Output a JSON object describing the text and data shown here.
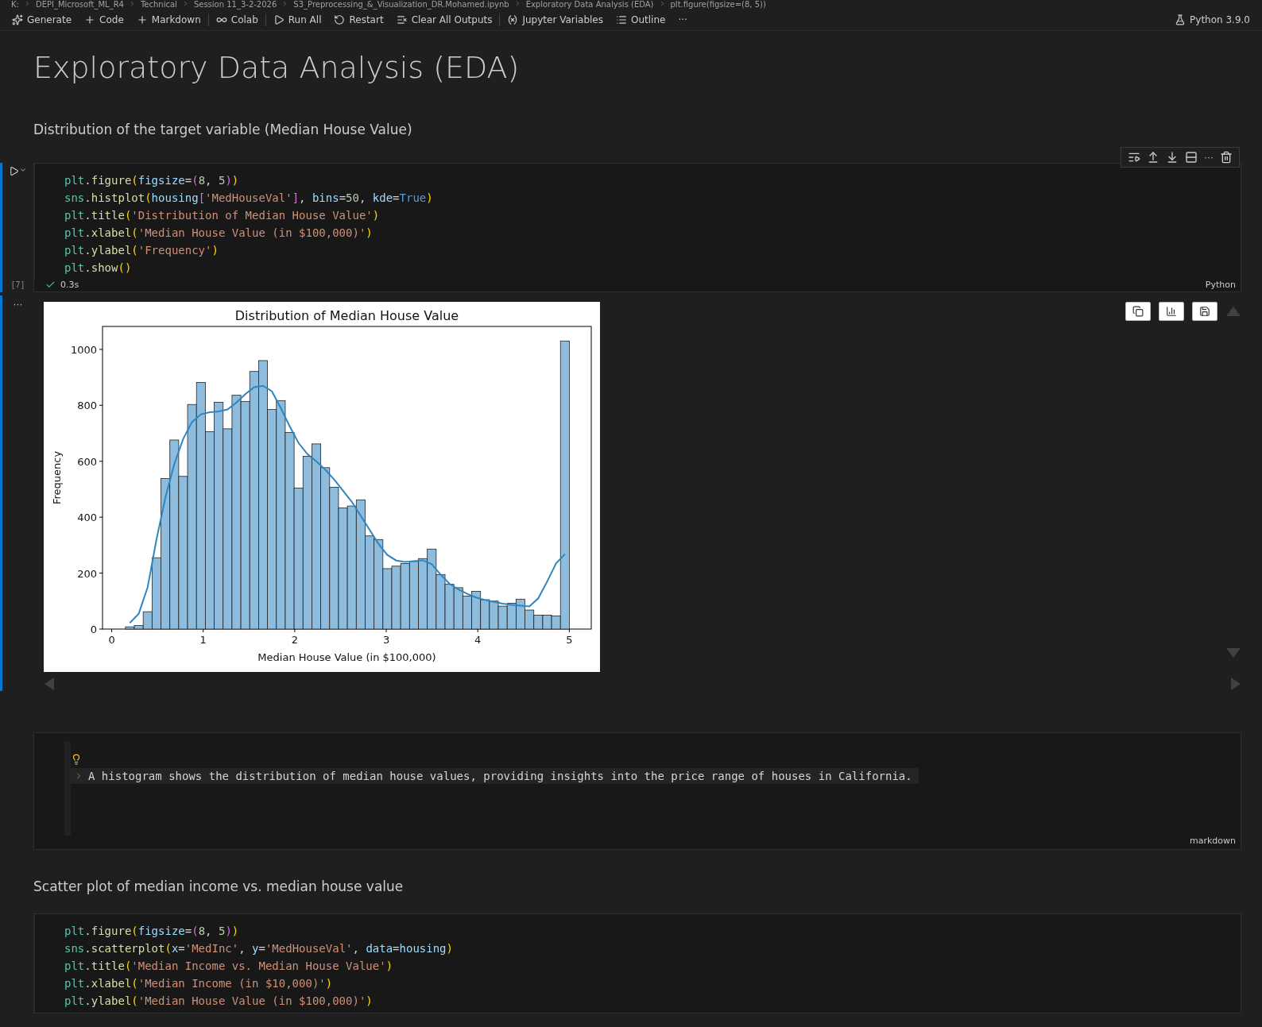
{
  "breadcrumb": [
    "K:",
    "DEPI_Microsoft_ML_R4",
    "Technical",
    "Session 11_3-2-2026",
    "S3_Preprocessing_&_Visualization_DR.Mohamed.ipynb",
    "Exploratory Data Analysis (EDA)",
    "plt.figure(figsize=(8, 5))"
  ],
  "toolbar": {
    "actions": [
      {
        "label": "Generate"
      },
      {
        "label": "Code"
      },
      {
        "label": "Markdown"
      },
      {
        "label": "Colab"
      },
      {
        "label": "Run All"
      },
      {
        "label": "Restart"
      },
      {
        "label": "Clear All Outputs"
      },
      {
        "label": "Jupyter Variables"
      },
      {
        "label": "Outline"
      }
    ],
    "more": "···",
    "kernel": "Python 3.9.0"
  },
  "heading": "Exploratory Data Analysis (EDA)",
  "subheading": "Distribution of the target variable (Median House Value)",
  "code_cell": {
    "lines": [
      "plt.figure(figsize=(8, 5))",
      "sns.histplot(housing['MedHouseVal'], bins=50, kde=True)",
      "plt.title('Distribution of Median House Value')",
      "plt.xlabel('Median House Value (in $100,000)')",
      "plt.ylabel('Frequency')",
      "plt.show()"
    ],
    "execution_count": "[7]",
    "succeeded": true,
    "duration": "0.3s",
    "language": "Python",
    "output_more": "···",
    "toolbar_more": "···"
  },
  "output": {
    "chart_data": {
      "type": "bar",
      "title": "Distribution of Median House Value",
      "xlabel": "Median House Value (in $100,000)",
      "ylabel": "Frequency",
      "x": [
        0.199,
        0.296,
        0.393,
        0.49,
        0.587,
        0.684,
        0.781,
        0.878,
        0.975,
        1.072,
        1.169,
        1.266,
        1.363,
        1.46,
        1.557,
        1.654,
        1.751,
        1.848,
        1.945,
        2.042,
        2.139,
        2.236,
        2.333,
        2.43,
        2.527,
        2.624,
        2.721,
        2.818,
        2.915,
        3.012,
        3.109,
        3.206,
        3.303,
        3.4,
        3.497,
        3.594,
        3.691,
        3.788,
        3.885,
        3.982,
        4.079,
        4.176,
        4.273,
        4.37,
        4.467,
        4.564,
        4.661,
        4.758,
        4.855,
        4.952
      ],
      "series": [
        {
          "type": "bar",
          "color": "#8ebcdc",
          "values": [
            8,
            13,
            62,
            255,
            538,
            676,
            546,
            803,
            882,
            706,
            811,
            716,
            836,
            814,
            921,
            960,
            785,
            817,
            703,
            504,
            618,
            662,
            577,
            507,
            433,
            440,
            462,
            333,
            320,
            216,
            225,
            234,
            242,
            252,
            286,
            195,
            160,
            148,
            118,
            135,
            105,
            100,
            82,
            92,
            107,
            68,
            50,
            50,
            47,
            1030
          ]
        },
        {
          "type": "line",
          "color": "#2e86c1",
          "values": [
            22,
            55,
            150,
            320,
            470,
            590,
            680,
            740,
            768,
            775,
            778,
            785,
            810,
            840,
            865,
            870,
            850,
            790,
            725,
            665,
            625,
            600,
            570,
            535,
            495,
            455,
            405,
            355,
            305,
            265,
            245,
            240,
            243,
            246,
            232,
            195,
            162,
            142,
            126,
            113,
            104,
            97,
            91,
            87,
            84,
            81,
            110,
            170,
            235,
            268
          ]
        }
      ],
      "stacked": false,
      "xlim": [
        -0.1,
        5.24
      ],
      "ylim": [
        0,
        1082
      ],
      "xticks": [
        0,
        1,
        2,
        3,
        4,
        5
      ],
      "yticks": [
        0,
        200,
        400,
        600,
        800,
        1000
      ]
    }
  },
  "markdown_cell": {
    "text": "A histogram shows the distribution of median house values, providing insights into the price range of houses in California.",
    "language": "markdown"
  },
  "subheading_2": "Scatter plot of median income vs. median house value",
  "code_cell_2": {
    "lines": [
      "plt.figure(figsize=(8, 5))",
      "sns.scatterplot(x='MedInc', y='MedHouseVal', data=housing)",
      "plt.title('Median Income vs. Median House Value')",
      "plt.xlabel('Median Income (in $10,000)')",
      "plt.ylabel('Median House Value (in $100,000)')"
    ]
  }
}
